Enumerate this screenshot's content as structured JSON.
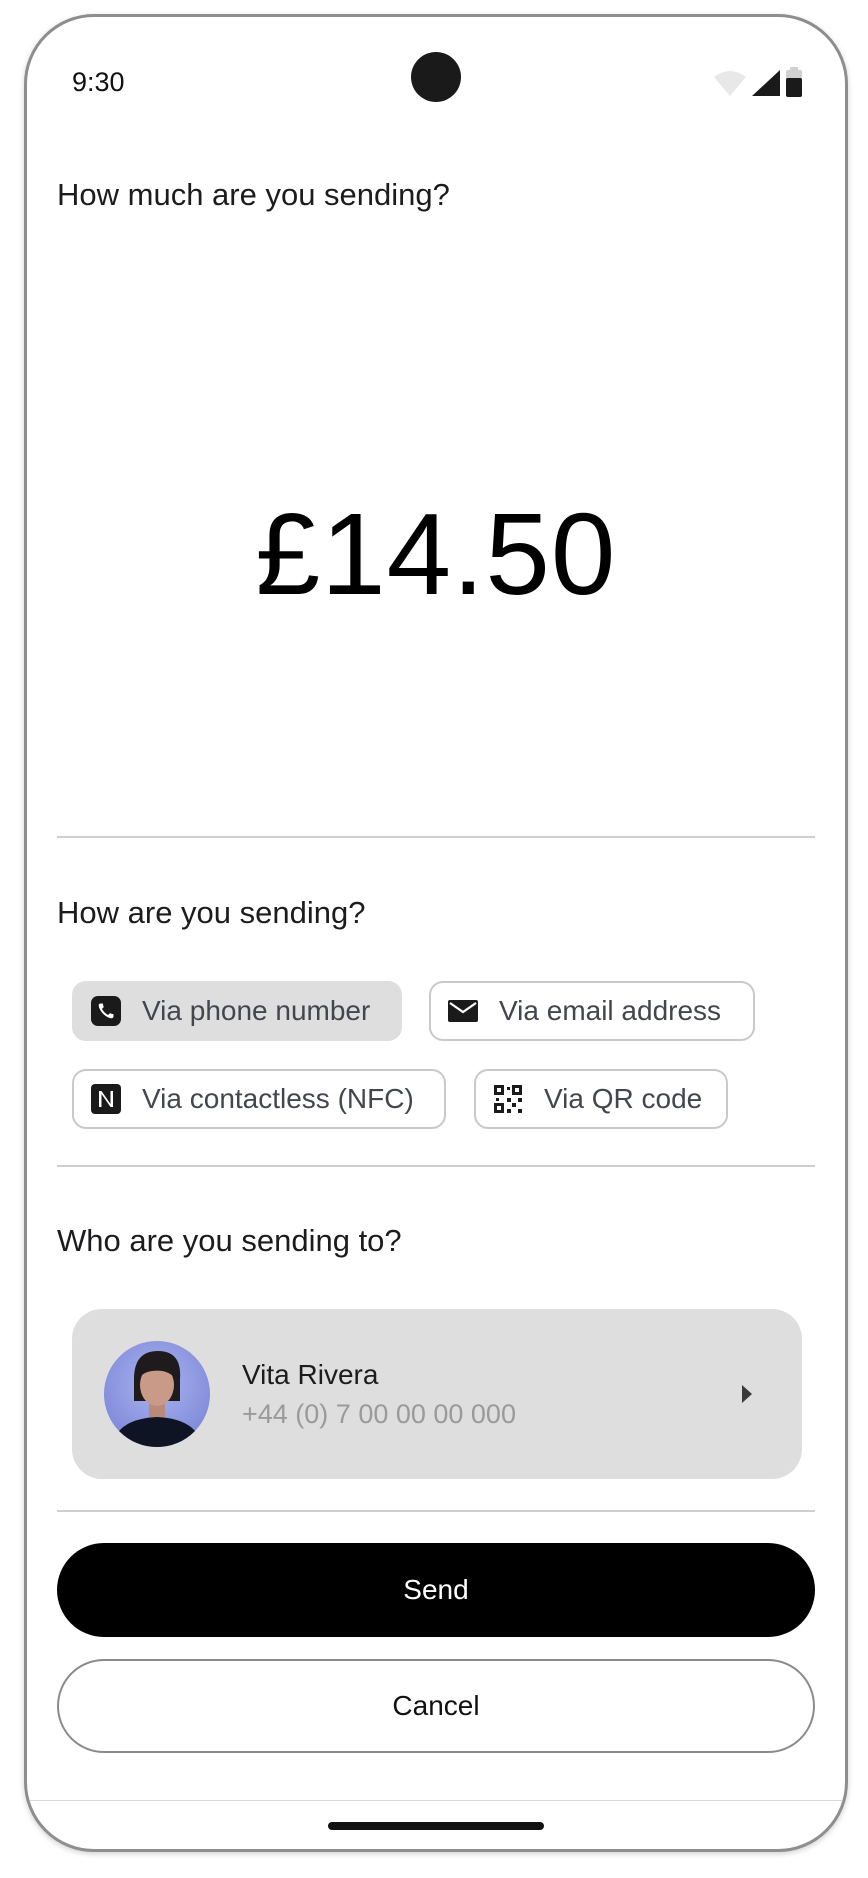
{
  "status_bar": {
    "time": "9:30",
    "icons": [
      "wifi-icon",
      "signal-icon",
      "battery-icon"
    ]
  },
  "amount_section": {
    "question": "How much are you sending?",
    "amount": "£14.50"
  },
  "method_section": {
    "question": "How are you sending?",
    "options": [
      {
        "label": "Via phone number",
        "icon": "phone-icon",
        "selected": true
      },
      {
        "label": "Via email address",
        "icon": "mail-icon",
        "selected": false
      },
      {
        "label": "Via contactless (NFC)",
        "icon": "nfc-icon",
        "selected": false
      },
      {
        "label": "Via QR code",
        "icon": "qr-code-icon",
        "selected": false
      }
    ]
  },
  "recipient_section": {
    "question": "Who are you sending to?",
    "recipient": {
      "name": "Vita Rivera",
      "phone": "+44 (0) 7 00 00 00 000"
    }
  },
  "actions": {
    "send_label": "Send",
    "cancel_label": "Cancel"
  },
  "colors": {
    "primary": "#000000",
    "chip_selected_bg": "#dedede",
    "card_bg": "#dedede",
    "muted_text": "#9a9a9a"
  }
}
